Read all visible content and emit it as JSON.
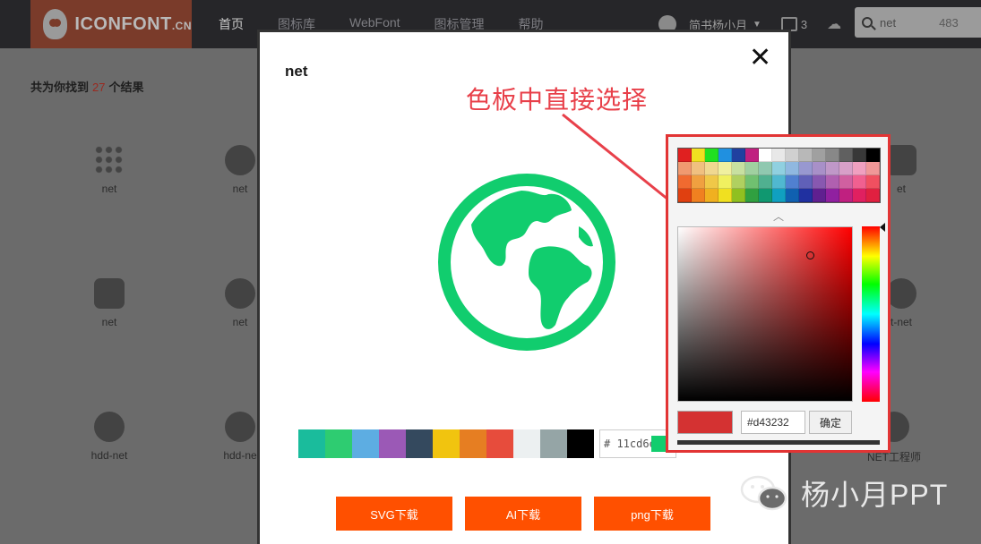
{
  "logo": {
    "text": "ICONFONT",
    "suffix": ".CN"
  },
  "nav": [
    "首页",
    "图标库",
    "WebFont",
    "图标管理",
    "帮助"
  ],
  "user": {
    "name": "简书杨小月",
    "cart_count": "3"
  },
  "search": {
    "value": "net",
    "count": "483"
  },
  "results": {
    "prefix": "共为你找到",
    "count": "27",
    "suffix": "个结果"
  },
  "bg_items": [
    "net",
    "net",
    "et",
    "net",
    "net",
    "t-net",
    "hdd-net",
    "hdd-ne",
    "NET工程师"
  ],
  "modal": {
    "title": "net",
    "close": "✕",
    "swatches": [
      "#1abc9c",
      "#2ecc71",
      "#5dade2",
      "#9b59b6",
      "#34495e",
      "#f1c40f",
      "#e67e22",
      "#e74c3c",
      "#ecf0f1",
      "#95a5a6",
      "#000000"
    ],
    "hex_value": "# 11cd6e",
    "icon_color": "#11cd6e",
    "buttons": {
      "svg": "SVG下载",
      "ai": "AI下载",
      "png": "png下载"
    }
  },
  "annotation": "色板中直接选择",
  "picker": {
    "palette": [
      "#e02020",
      "#f0e020",
      "#20e020",
      "#2090e0",
      "#2040a0",
      "#c02080",
      "#ffffff",
      "#e8e8e8",
      "#d0d0d0",
      "#b8b8b8",
      "#a0a0a0",
      "#888888",
      "#606060",
      "#383838",
      "#000000",
      "#f09a70",
      "#f0c080",
      "#f0d890",
      "#f0f0a0",
      "#c8e0a0",
      "#a0d0a0",
      "#90c8b0",
      "#90d0e0",
      "#90b8e0",
      "#9898d0",
      "#a890c8",
      "#c098c8",
      "#d8a0c8",
      "#f0a0c0",
      "#f09898",
      "#f06a30",
      "#f0a040",
      "#f0c848",
      "#f0f060",
      "#b0d060",
      "#70c070",
      "#50b090",
      "#50b8d0",
      "#5080d0",
      "#6060b8",
      "#8858b0",
      "#b060b0",
      "#d060a0",
      "#f06090",
      "#f05060",
      "#e04010",
      "#f08020",
      "#f0b020",
      "#f0e020",
      "#90c020",
      "#30a040",
      "#109870",
      "#10a0c0",
      "#1060b0",
      "#2030a0",
      "#602090",
      "#9020a0",
      "#c02080",
      "#e02060",
      "#e02040"
    ],
    "collapse": "︿",
    "current_color": "#d43232",
    "hex": "#d43232",
    "confirm": "确定"
  },
  "watermark": "杨小月PPT"
}
